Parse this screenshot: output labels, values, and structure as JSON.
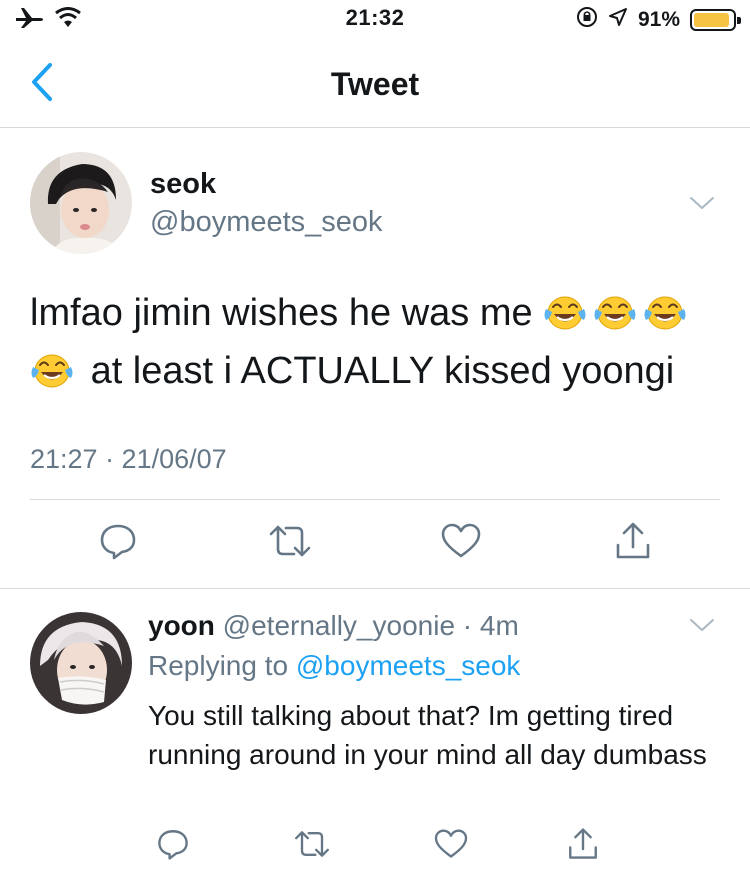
{
  "status_bar": {
    "time": "21:32",
    "battery_percent": "91%",
    "battery_level": 0.91,
    "icons": [
      "airplane-icon",
      "wifi-icon",
      "orientation-lock-icon",
      "location-icon",
      "battery-icon"
    ]
  },
  "nav": {
    "title": "Tweet",
    "back_icon": "chevron-left-icon"
  },
  "tweet": {
    "author_name": "seok",
    "author_handle": "@boymeets_seok",
    "text_line1": "lmfao jimin wishes he was me",
    "text_line2": "at least i ACTUALLY kissed yoongi",
    "emoji_name": "face-with-tears-of-joy",
    "emoji_count": 4,
    "timestamp": "21:27 · 21/06/07",
    "actions": [
      "reply-icon",
      "retweet-icon",
      "like-icon",
      "share-icon"
    ]
  },
  "reply": {
    "author_name": "yoon",
    "author_handle": "@eternally_yoonie · 4m",
    "replying_prefix": "Replying to ",
    "replying_to": "@boymeets_seok",
    "text": "You still talking about that? Im getting tired running around in your mind all day dumbass",
    "actions": [
      "reply-icon",
      "retweet-icon",
      "like-icon",
      "share-icon"
    ]
  },
  "colors": {
    "accent": "#1da1f2",
    "text_primary": "#14171a",
    "text_secondary": "#657786",
    "divider": "#d6d9db",
    "icon_gray": "#657786",
    "battery_fill": "#f5c242"
  }
}
